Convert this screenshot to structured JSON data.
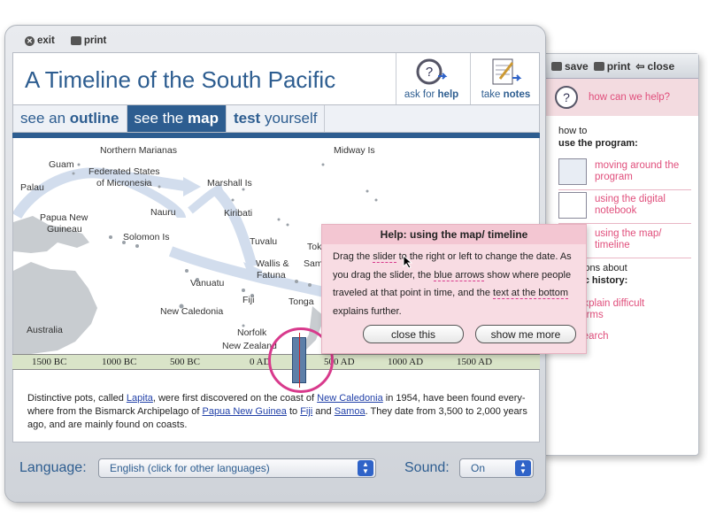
{
  "toolbar": {
    "exit_label": "exit",
    "print_label": "print"
  },
  "header": {
    "title": "A Timeline of the South Pacific",
    "ask_help_pre": "ask for ",
    "ask_help_bold": "help",
    "take_notes_pre": "take ",
    "take_notes_bold": "notes"
  },
  "tabs": [
    {
      "pre": "see an ",
      "bold": "outline"
    },
    {
      "pre": "see the ",
      "bold": "map"
    },
    {
      "bold": "test",
      "post": " yourself"
    }
  ],
  "map_labels": [
    "Northern Marianas",
    "Midway Is",
    "Guam",
    "Federated States",
    "of Micronesia",
    "Marshall Is",
    "Palau",
    "Papua New",
    "Guineau",
    "Nauru",
    "Kiribati",
    "Solomon Is",
    "Tuvalu",
    "Tokelau",
    "Wallis &",
    "Fatuna",
    "Samoa",
    "Vanuatu",
    "Fiji",
    "Tonga",
    "New Caledonia",
    "Australia",
    "Norfolk",
    "New Zealand"
  ],
  "timeline": [
    "1500 BC",
    "1000 BC",
    "500 BC",
    "0 AD",
    "500 AD",
    "1000 AD",
    "1500 AD"
  ],
  "description": {
    "t1": "Distinctive pots, called ",
    "l1": "Lapita",
    "t2": ", were first discovered on the coast of ",
    "l2": "New Caledonia",
    "t3": " in 1954, have been found every-where from the Bismarck Archipelago of ",
    "l3": "Papua New Guinea",
    "t4": " to ",
    "l4": "Fiji",
    "t5": " and ",
    "l5": "Samoa",
    "t6": ". They date from 3,500 to 2,000 years ago, and are mainly found on coasts."
  },
  "footer": {
    "language_label": "Language:",
    "language_value": "English (click for other languages)",
    "sound_label": "Sound:",
    "sound_value": "On"
  },
  "help_popup": {
    "title": "Help: using the map/ timeline",
    "b1": "Drag the ",
    "k1": "slider",
    "b2": " to the right or left to change the date. As you drag the slider, the ",
    "k2": "blue arrows",
    "b3": " show where people traveled at that point in time, and the ",
    "k3": "text at the bottom",
    "b4": " explains further.",
    "close_label": "close this",
    "more_label": "show me more"
  },
  "side": {
    "save_label": "save",
    "print_label": "print",
    "close_label": "close",
    "help_link": "how can we help?",
    "how_to": "how to",
    "use_program": "use the program:",
    "items": [
      "moving around the program",
      "using the digital notebook",
      "using the map/ timeline"
    ],
    "questions_about": "questions about",
    "pacific_history": "pacific history:",
    "explain_terms": "explain difficult terms",
    "search": "search"
  }
}
